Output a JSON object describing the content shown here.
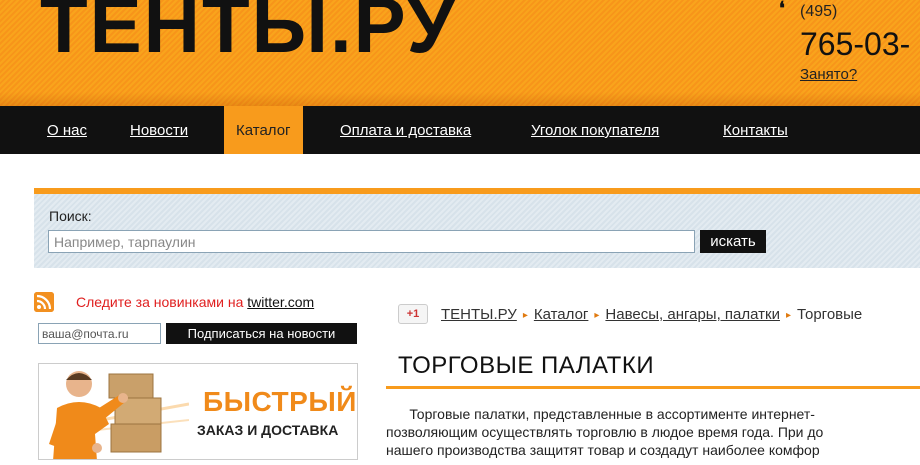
{
  "header": {
    "logo": "ТЕНТЫ.РУ",
    "phone_code": "(495)",
    "phone_number": "765-03-",
    "busy_link": "Занято?"
  },
  "nav": {
    "items": [
      {
        "label": "О нас"
      },
      {
        "label": "Новости"
      },
      {
        "label": "Каталог",
        "active": true
      },
      {
        "label": "Оплата и доставка"
      },
      {
        "label": "Уголок покупателя"
      },
      {
        "label": "Контакты"
      }
    ]
  },
  "search": {
    "label": "Поиск:",
    "placeholder": "Например, тарпаулин",
    "button": "искать"
  },
  "sidebar": {
    "twitter_text": "Следите за новинками на ",
    "twitter_link": "twitter.com",
    "email_placeholder": "ваша@почта.ru",
    "subscribe_button": "Подписаться на новости",
    "banner_title": "БЫСТРЫЙ",
    "banner_subtitle": "ЗАКАЗ И ДОСТАВКА"
  },
  "gplus": "+1",
  "breadcrumb": [
    {
      "label": "ТЕНТЫ.РУ"
    },
    {
      "label": "Каталог"
    },
    {
      "label": "Навесы, ангары, палатки"
    },
    {
      "label": "Торговые"
    }
  ],
  "page_title": "ТОРГОВЫЕ ПАЛАТКИ",
  "paragraph_lines": [
    "      Торговые палатки, представленные в ассортименте интернет-",
    "позволяющим осуществлять торговлю в людое время года. При до",
    "нашего производства защитят товар и создадут наиболее комфор"
  ],
  "colors": {
    "accent": "#f89b1c",
    "nav_bg": "#111111",
    "link_red": "#e02020"
  }
}
